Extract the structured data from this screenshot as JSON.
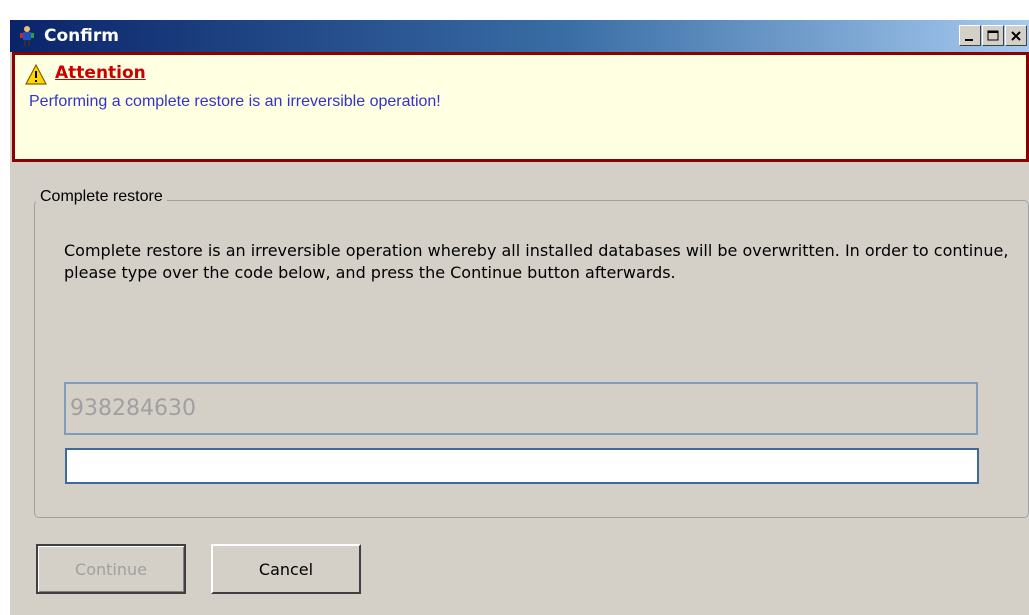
{
  "window": {
    "title": "Confirm",
    "title_icon": "app-person-icon",
    "controls": [
      "minimize-icon",
      "maximize-icon",
      "close-icon"
    ]
  },
  "banner": {
    "icon": "warning-icon",
    "title": "Attention",
    "message": "Performing a complete restore is an irreversible operation!"
  },
  "group": {
    "legend": "Complete restore",
    "description": "Complete restore is an irreversible operation whereby all installed databases will be overwritten. In order to continue, please type over the code below, and press the Continue button afterwards."
  },
  "code": {
    "value": "938284630"
  },
  "input": {
    "value": ""
  },
  "buttons": {
    "continue_label": "Continue",
    "cancel_label": "Cancel"
  },
  "colors": {
    "titlebar_start": "#0a246a",
    "banner_bg": "#ffffe1",
    "banner_border": "#8b0000",
    "attention_red": "#cc0000",
    "message_blue": "#3333cc"
  }
}
